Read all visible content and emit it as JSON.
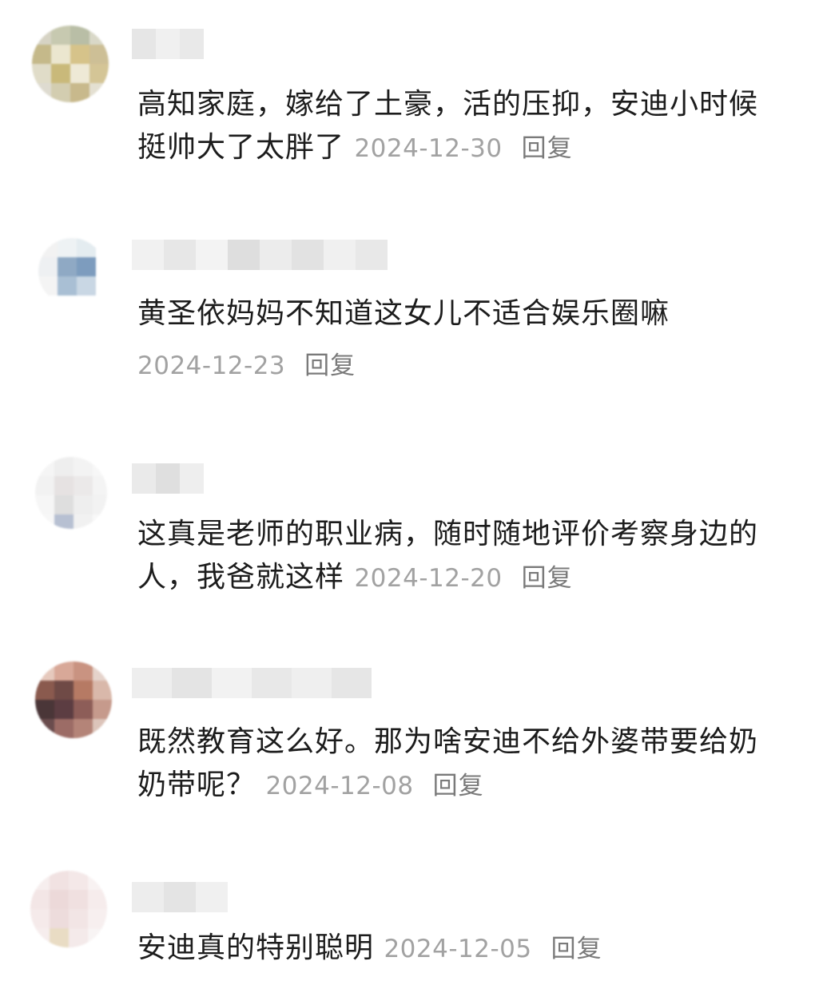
{
  "comments": [
    {
      "text": "高知家庭，嫁给了土豪，活的压抑，安迪小时候挺帅大了太胖了 ",
      "date": "2024-12-30",
      "reply_label": "回复"
    },
    {
      "text": "黄圣依妈妈不知道这女儿不适合娱乐圈嘛",
      "date": "2024-12-23",
      "reply_label": "回复"
    },
    {
      "text": "这真是老师的职业病，随时随地评价考察身边的人，我爸就这样 ",
      "date": "2024-12-20",
      "reply_label": "回复"
    },
    {
      "text": "既然教育这么好。那为啥安迪不给外婆带要给奶奶带呢？ ",
      "date": "2024-12-08",
      "reply_label": "回复"
    },
    {
      "text": "安迪真的特别聪明 ",
      "date": "2024-12-05",
      "reply_label": "回复"
    }
  ],
  "colors": {
    "text": "#1c1c1c",
    "date": "#a2a2a2",
    "reply": "#7a7a7a",
    "background": "#ffffff"
  }
}
